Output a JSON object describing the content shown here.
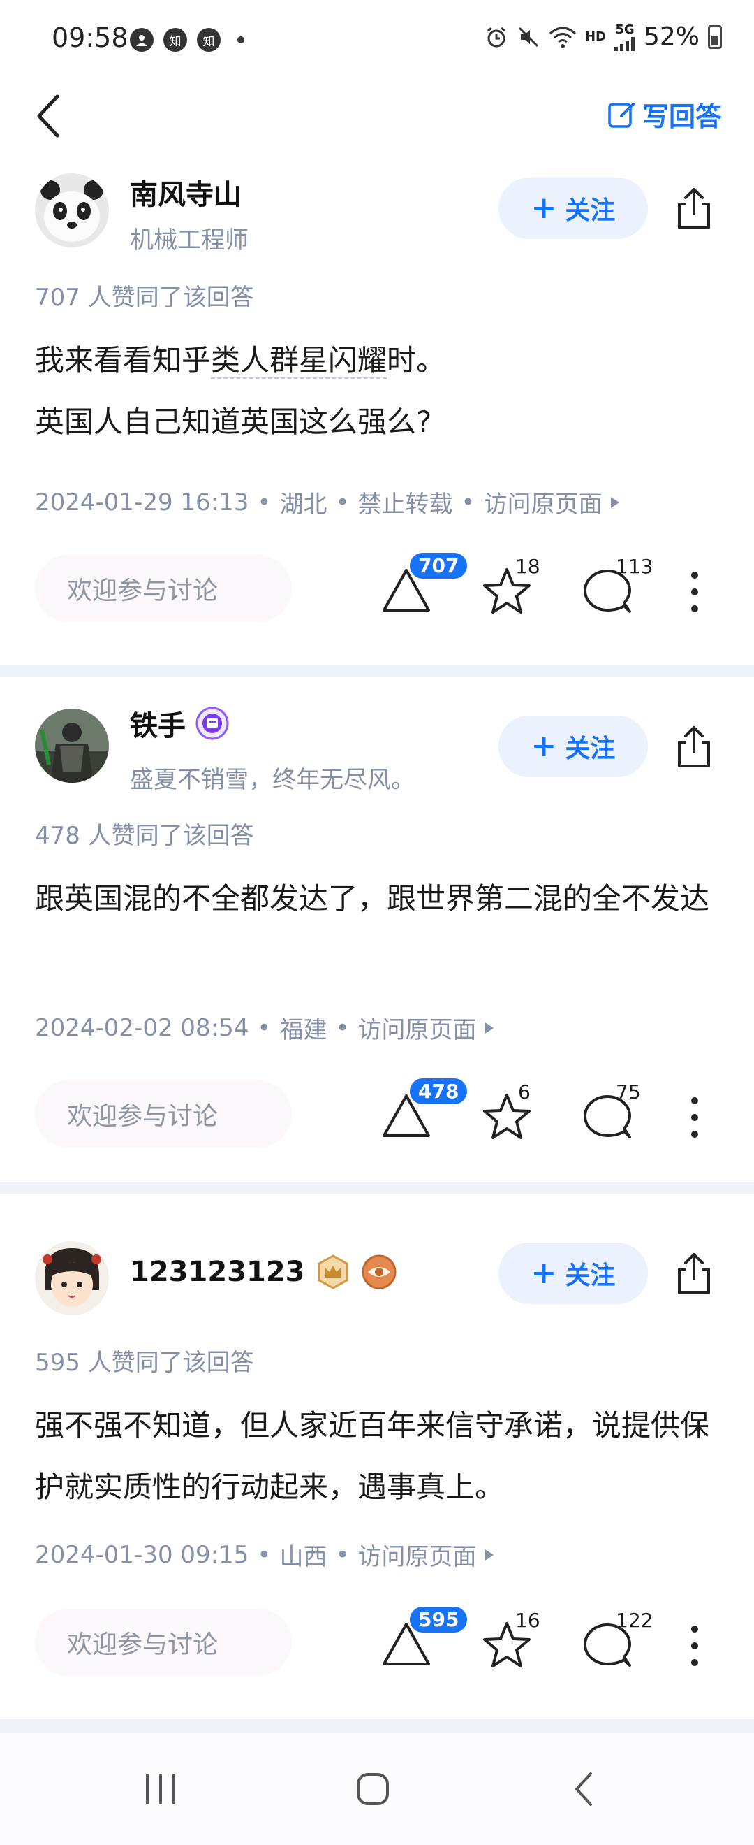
{
  "status_bar": {
    "time": "09:58",
    "icon_labels": [
      "知",
      "知"
    ],
    "network": "5G",
    "hd": "HD",
    "battery": "52%"
  },
  "header": {
    "write_answer_label": "写回答",
    "accent_color": "#1772f6"
  },
  "answers": [
    {
      "author": "南风寺山",
      "bio": "机械工程师",
      "follow_label": "关注",
      "vote_line": "707 人赞同了该回答",
      "paragraphs": [
        "我来看看知乎",
        "类人群星闪耀",
        "时。",
        "英国人自己知道英国这么强么?"
      ],
      "meta": {
        "datetime": "2024-01-29 16:13",
        "location": "湖北",
        "extra": "禁止转载",
        "link": "访问原页面"
      },
      "discuss_placeholder": "欢迎参与讨论",
      "upvotes": "707",
      "favorites": "18",
      "comments": "113"
    },
    {
      "author": "铁手",
      "bio": "盛夏不销雪，终年无尽风。",
      "follow_label": "关注",
      "vote_line": "478 人赞同了该回答",
      "paragraphs": [
        "跟英国混的不全都发达了，跟世界第二混的全不发达"
      ],
      "meta": {
        "datetime": "2024-02-02 08:54",
        "location": "福建",
        "link": "访问原页面"
      },
      "discuss_placeholder": "欢迎参与讨论",
      "upvotes": "478",
      "favorites": "6",
      "comments": "75"
    },
    {
      "author": "123123123",
      "follow_label": "关注",
      "vote_line": "595 人赞同了该回答",
      "paragraphs": [
        "强不强不知道，但人家近百年来信守承诺，说提供保护就实质性的行动起来，遇事真上。"
      ],
      "meta": {
        "datetime": "2024-01-30 09:15",
        "location": "山西",
        "link": "访问原页面"
      },
      "discuss_placeholder": "欢迎参与讨论",
      "upvotes": "595",
      "favorites": "16",
      "comments": "122"
    }
  ]
}
